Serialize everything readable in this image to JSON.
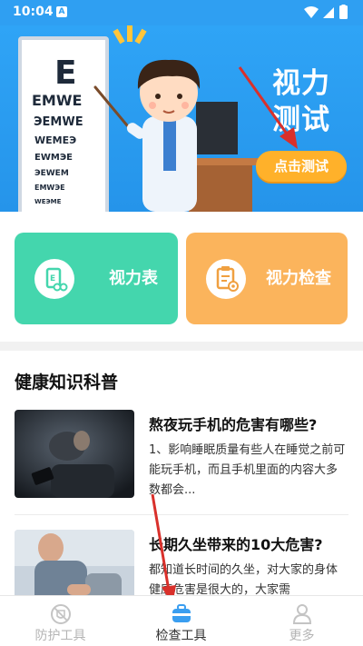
{
  "status_bar": {
    "time": "10:04",
    "app_icon": "A"
  },
  "banner": {
    "title_line1": "视力",
    "title_line2": "测试",
    "button_label": "点击测试",
    "eye_chart_letter": "E",
    "colors": {
      "background": "#2fa4f6",
      "button": "#ffb12a"
    }
  },
  "features": [
    {
      "label": "视力表",
      "icon": "eye-chart-icon",
      "color": "#44d6ad"
    },
    {
      "label": "视力检查",
      "icon": "eye-check-clipboard-icon",
      "color": "#fbb45c"
    }
  ],
  "section_title": "健康知识科普",
  "articles": [
    {
      "title": "熬夜玩手机的危害有哪些?",
      "desc": "1、影响睡眠质量有些人在睡觉之前可能玩手机，而且手机里面的内容大多数都会..."
    },
    {
      "title": "长期久坐带来的10大危害?",
      "desc": "都知道长时间的久坐，对大家的身体健康危害是很大的，大家需"
    }
  ],
  "bottom_nav": [
    {
      "label": "防护工具",
      "icon": "shield-icon",
      "active": false
    },
    {
      "label": "检查工具",
      "icon": "toolbox-icon",
      "active": true
    },
    {
      "label": "更多",
      "icon": "person-icon",
      "active": false
    }
  ]
}
